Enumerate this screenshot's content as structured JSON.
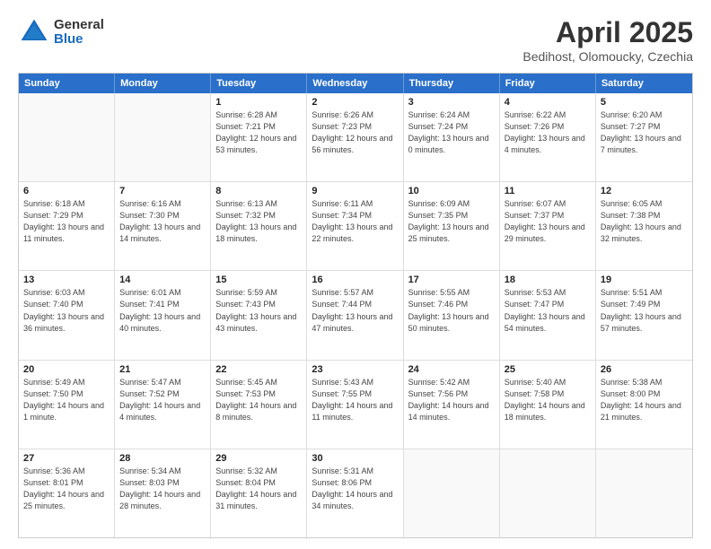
{
  "logo": {
    "general": "General",
    "blue": "Blue"
  },
  "header": {
    "title": "April 2025",
    "subtitle": "Bedihost, Olomoucky, Czechia"
  },
  "weekdays": [
    "Sunday",
    "Monday",
    "Tuesday",
    "Wednesday",
    "Thursday",
    "Friday",
    "Saturday"
  ],
  "rows": [
    [
      {
        "day": "",
        "sunrise": "",
        "sunset": "",
        "daylight": ""
      },
      {
        "day": "",
        "sunrise": "",
        "sunset": "",
        "daylight": ""
      },
      {
        "day": "1",
        "sunrise": "Sunrise: 6:28 AM",
        "sunset": "Sunset: 7:21 PM",
        "daylight": "Daylight: 12 hours and 53 minutes."
      },
      {
        "day": "2",
        "sunrise": "Sunrise: 6:26 AM",
        "sunset": "Sunset: 7:23 PM",
        "daylight": "Daylight: 12 hours and 56 minutes."
      },
      {
        "day": "3",
        "sunrise": "Sunrise: 6:24 AM",
        "sunset": "Sunset: 7:24 PM",
        "daylight": "Daylight: 13 hours and 0 minutes."
      },
      {
        "day": "4",
        "sunrise": "Sunrise: 6:22 AM",
        "sunset": "Sunset: 7:26 PM",
        "daylight": "Daylight: 13 hours and 4 minutes."
      },
      {
        "day": "5",
        "sunrise": "Sunrise: 6:20 AM",
        "sunset": "Sunset: 7:27 PM",
        "daylight": "Daylight: 13 hours and 7 minutes."
      }
    ],
    [
      {
        "day": "6",
        "sunrise": "Sunrise: 6:18 AM",
        "sunset": "Sunset: 7:29 PM",
        "daylight": "Daylight: 13 hours and 11 minutes."
      },
      {
        "day": "7",
        "sunrise": "Sunrise: 6:16 AM",
        "sunset": "Sunset: 7:30 PM",
        "daylight": "Daylight: 13 hours and 14 minutes."
      },
      {
        "day": "8",
        "sunrise": "Sunrise: 6:13 AM",
        "sunset": "Sunset: 7:32 PM",
        "daylight": "Daylight: 13 hours and 18 minutes."
      },
      {
        "day": "9",
        "sunrise": "Sunrise: 6:11 AM",
        "sunset": "Sunset: 7:34 PM",
        "daylight": "Daylight: 13 hours and 22 minutes."
      },
      {
        "day": "10",
        "sunrise": "Sunrise: 6:09 AM",
        "sunset": "Sunset: 7:35 PM",
        "daylight": "Daylight: 13 hours and 25 minutes."
      },
      {
        "day": "11",
        "sunrise": "Sunrise: 6:07 AM",
        "sunset": "Sunset: 7:37 PM",
        "daylight": "Daylight: 13 hours and 29 minutes."
      },
      {
        "day": "12",
        "sunrise": "Sunrise: 6:05 AM",
        "sunset": "Sunset: 7:38 PM",
        "daylight": "Daylight: 13 hours and 32 minutes."
      }
    ],
    [
      {
        "day": "13",
        "sunrise": "Sunrise: 6:03 AM",
        "sunset": "Sunset: 7:40 PM",
        "daylight": "Daylight: 13 hours and 36 minutes."
      },
      {
        "day": "14",
        "sunrise": "Sunrise: 6:01 AM",
        "sunset": "Sunset: 7:41 PM",
        "daylight": "Daylight: 13 hours and 40 minutes."
      },
      {
        "day": "15",
        "sunrise": "Sunrise: 5:59 AM",
        "sunset": "Sunset: 7:43 PM",
        "daylight": "Daylight: 13 hours and 43 minutes."
      },
      {
        "day": "16",
        "sunrise": "Sunrise: 5:57 AM",
        "sunset": "Sunset: 7:44 PM",
        "daylight": "Daylight: 13 hours and 47 minutes."
      },
      {
        "day": "17",
        "sunrise": "Sunrise: 5:55 AM",
        "sunset": "Sunset: 7:46 PM",
        "daylight": "Daylight: 13 hours and 50 minutes."
      },
      {
        "day": "18",
        "sunrise": "Sunrise: 5:53 AM",
        "sunset": "Sunset: 7:47 PM",
        "daylight": "Daylight: 13 hours and 54 minutes."
      },
      {
        "day": "19",
        "sunrise": "Sunrise: 5:51 AM",
        "sunset": "Sunset: 7:49 PM",
        "daylight": "Daylight: 13 hours and 57 minutes."
      }
    ],
    [
      {
        "day": "20",
        "sunrise": "Sunrise: 5:49 AM",
        "sunset": "Sunset: 7:50 PM",
        "daylight": "Daylight: 14 hours and 1 minute."
      },
      {
        "day": "21",
        "sunrise": "Sunrise: 5:47 AM",
        "sunset": "Sunset: 7:52 PM",
        "daylight": "Daylight: 14 hours and 4 minutes."
      },
      {
        "day": "22",
        "sunrise": "Sunrise: 5:45 AM",
        "sunset": "Sunset: 7:53 PM",
        "daylight": "Daylight: 14 hours and 8 minutes."
      },
      {
        "day": "23",
        "sunrise": "Sunrise: 5:43 AM",
        "sunset": "Sunset: 7:55 PM",
        "daylight": "Daylight: 14 hours and 11 minutes."
      },
      {
        "day": "24",
        "sunrise": "Sunrise: 5:42 AM",
        "sunset": "Sunset: 7:56 PM",
        "daylight": "Daylight: 14 hours and 14 minutes."
      },
      {
        "day": "25",
        "sunrise": "Sunrise: 5:40 AM",
        "sunset": "Sunset: 7:58 PM",
        "daylight": "Daylight: 14 hours and 18 minutes."
      },
      {
        "day": "26",
        "sunrise": "Sunrise: 5:38 AM",
        "sunset": "Sunset: 8:00 PM",
        "daylight": "Daylight: 14 hours and 21 minutes."
      }
    ],
    [
      {
        "day": "27",
        "sunrise": "Sunrise: 5:36 AM",
        "sunset": "Sunset: 8:01 PM",
        "daylight": "Daylight: 14 hours and 25 minutes."
      },
      {
        "day": "28",
        "sunrise": "Sunrise: 5:34 AM",
        "sunset": "Sunset: 8:03 PM",
        "daylight": "Daylight: 14 hours and 28 minutes."
      },
      {
        "day": "29",
        "sunrise": "Sunrise: 5:32 AM",
        "sunset": "Sunset: 8:04 PM",
        "daylight": "Daylight: 14 hours and 31 minutes."
      },
      {
        "day": "30",
        "sunrise": "Sunrise: 5:31 AM",
        "sunset": "Sunset: 8:06 PM",
        "daylight": "Daylight: 14 hours and 34 minutes."
      },
      {
        "day": "",
        "sunrise": "",
        "sunset": "",
        "daylight": ""
      },
      {
        "day": "",
        "sunrise": "",
        "sunset": "",
        "daylight": ""
      },
      {
        "day": "",
        "sunrise": "",
        "sunset": "",
        "daylight": ""
      }
    ]
  ]
}
